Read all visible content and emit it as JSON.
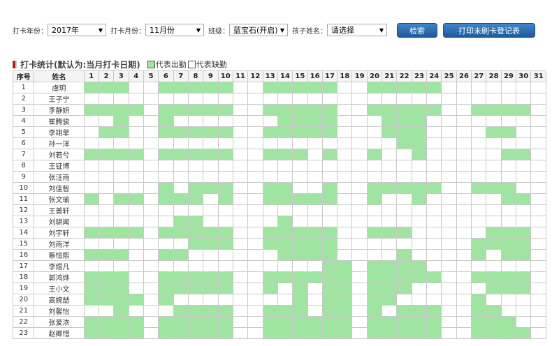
{
  "filters": {
    "year_label": "打卡年份：",
    "year_value": "2017年",
    "month_label": "打卡月份：",
    "month_value": "11月份",
    "class_label": "班级：",
    "class_value": "蓝宝石(开启)",
    "child_label": "孩子姓名：",
    "child_value": "请选择",
    "search_button": "检索",
    "print_button": "打印未刷卡登记表"
  },
  "section": {
    "title": "打卡统计(默认为:当月打卡日期)",
    "legend_present": "代表出勤",
    "legend_absent": "代表缺勤"
  },
  "colors": {
    "present": "#9fe5a1",
    "absent": "#ffffff",
    "button": "#2a6db0",
    "title_mark": "#b22222"
  },
  "table": {
    "headers": {
      "seq": "序号",
      "name": "姓名"
    },
    "days": [
      "1",
      "2",
      "3",
      "4",
      "5",
      "6",
      "7",
      "8",
      "9",
      "10",
      "11",
      "12",
      "13",
      "14",
      "15",
      "16",
      "17",
      "18",
      "19",
      "20",
      "21",
      "22",
      "23",
      "24",
      "25",
      "26",
      "27",
      "28",
      "29",
      "30",
      "31"
    ],
    "rows": [
      {
        "seq": "1",
        "name": "虞玥",
        "att": "1110011111001111100111110000000"
      },
      {
        "seq": "2",
        "name": "王子宁",
        "att": "0000000000000000000000000000000"
      },
      {
        "seq": "3",
        "name": "李静妍",
        "att": "1111011111001111100111110011110"
      },
      {
        "seq": "4",
        "name": "崔腾骏",
        "att": "0010010000000111100011100000000"
      },
      {
        "seq": "5",
        "name": "李翊菲",
        "att": "0110011111001111100011100001100"
      },
      {
        "seq": "6",
        "name": "孙一洋",
        "att": "0000000000000000000001100000000"
      },
      {
        "seq": "7",
        "name": "刘若兮",
        "att": "1111011111001110100100100000110"
      },
      {
        "seq": "8",
        "name": "王钲博",
        "att": "0000000000000000000000000000000"
      },
      {
        "seq": "9",
        "name": "张汪雨",
        "att": "0000000000000000000000000000000"
      },
      {
        "seq": "10",
        "name": "刘佳智",
        "att": "0000010111001100100111110011100"
      },
      {
        "seq": "11",
        "name": "张文瑜",
        "att": "1011011101001111100100100000110"
      },
      {
        "seq": "12",
        "name": "王普轩",
        "att": "0000000000000000000000000000000"
      },
      {
        "seq": "13",
        "name": "刘骐闻",
        "att": "0000001100000100000000000000000"
      },
      {
        "seq": "14",
        "name": "刘宇轩",
        "att": "1111011111001111100111000001110"
      },
      {
        "seq": "15",
        "name": "刘雨洋",
        "att": "0000000111001111100000000011110"
      },
      {
        "seq": "16",
        "name": "蔡恒熙",
        "att": "1110011000000111100001000010110"
      },
      {
        "seq": "17",
        "name": "李煜凡",
        "att": "0000000000000000110111100000000"
      },
      {
        "seq": "18",
        "name": "郭鸿烨",
        "att": "1110011111001111110111110011110"
      },
      {
        "seq": "19",
        "name": "王小文",
        "att": "1110011111001010110111000001110"
      },
      {
        "seq": "20",
        "name": "高婉喆",
        "att": "1111010000000010110110000010000"
      },
      {
        "seq": "21",
        "name": "刘馨怡",
        "att": "0010001111001110110101110011000"
      },
      {
        "seq": "22",
        "name": "张爱浓",
        "att": "1111011111001111110111110011100"
      },
      {
        "seq": "23",
        "name": "赵卿惜",
        "att": "1111011111001111110111110011110"
      }
    ]
  }
}
